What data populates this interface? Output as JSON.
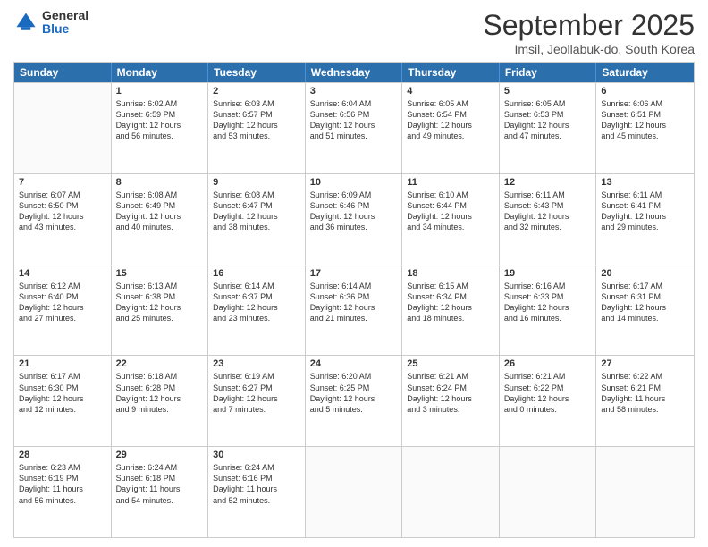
{
  "logo": {
    "general": "General",
    "blue": "Blue"
  },
  "header": {
    "title": "September 2025",
    "subtitle": "Imsil, Jeollabuk-do, South Korea"
  },
  "days": [
    "Sunday",
    "Monday",
    "Tuesday",
    "Wednesday",
    "Thursday",
    "Friday",
    "Saturday"
  ],
  "weeks": [
    [
      {
        "day": "",
        "empty": true
      },
      {
        "day": "1",
        "lines": [
          "Sunrise: 6:02 AM",
          "Sunset: 6:59 PM",
          "Daylight: 12 hours",
          "and 56 minutes."
        ]
      },
      {
        "day": "2",
        "lines": [
          "Sunrise: 6:03 AM",
          "Sunset: 6:57 PM",
          "Daylight: 12 hours",
          "and 53 minutes."
        ]
      },
      {
        "day": "3",
        "lines": [
          "Sunrise: 6:04 AM",
          "Sunset: 6:56 PM",
          "Daylight: 12 hours",
          "and 51 minutes."
        ]
      },
      {
        "day": "4",
        "lines": [
          "Sunrise: 6:05 AM",
          "Sunset: 6:54 PM",
          "Daylight: 12 hours",
          "and 49 minutes."
        ]
      },
      {
        "day": "5",
        "lines": [
          "Sunrise: 6:05 AM",
          "Sunset: 6:53 PM",
          "Daylight: 12 hours",
          "and 47 minutes."
        ]
      },
      {
        "day": "6",
        "lines": [
          "Sunrise: 6:06 AM",
          "Sunset: 6:51 PM",
          "Daylight: 12 hours",
          "and 45 minutes."
        ]
      }
    ],
    [
      {
        "day": "7",
        "lines": [
          "Sunrise: 6:07 AM",
          "Sunset: 6:50 PM",
          "Daylight: 12 hours",
          "and 43 minutes."
        ]
      },
      {
        "day": "8",
        "lines": [
          "Sunrise: 6:08 AM",
          "Sunset: 6:49 PM",
          "Daylight: 12 hours",
          "and 40 minutes."
        ]
      },
      {
        "day": "9",
        "lines": [
          "Sunrise: 6:08 AM",
          "Sunset: 6:47 PM",
          "Daylight: 12 hours",
          "and 38 minutes."
        ]
      },
      {
        "day": "10",
        "lines": [
          "Sunrise: 6:09 AM",
          "Sunset: 6:46 PM",
          "Daylight: 12 hours",
          "and 36 minutes."
        ]
      },
      {
        "day": "11",
        "lines": [
          "Sunrise: 6:10 AM",
          "Sunset: 6:44 PM",
          "Daylight: 12 hours",
          "and 34 minutes."
        ]
      },
      {
        "day": "12",
        "lines": [
          "Sunrise: 6:11 AM",
          "Sunset: 6:43 PM",
          "Daylight: 12 hours",
          "and 32 minutes."
        ]
      },
      {
        "day": "13",
        "lines": [
          "Sunrise: 6:11 AM",
          "Sunset: 6:41 PM",
          "Daylight: 12 hours",
          "and 29 minutes."
        ]
      }
    ],
    [
      {
        "day": "14",
        "lines": [
          "Sunrise: 6:12 AM",
          "Sunset: 6:40 PM",
          "Daylight: 12 hours",
          "and 27 minutes."
        ]
      },
      {
        "day": "15",
        "lines": [
          "Sunrise: 6:13 AM",
          "Sunset: 6:38 PM",
          "Daylight: 12 hours",
          "and 25 minutes."
        ]
      },
      {
        "day": "16",
        "lines": [
          "Sunrise: 6:14 AM",
          "Sunset: 6:37 PM",
          "Daylight: 12 hours",
          "and 23 minutes."
        ]
      },
      {
        "day": "17",
        "lines": [
          "Sunrise: 6:14 AM",
          "Sunset: 6:36 PM",
          "Daylight: 12 hours",
          "and 21 minutes."
        ]
      },
      {
        "day": "18",
        "lines": [
          "Sunrise: 6:15 AM",
          "Sunset: 6:34 PM",
          "Daylight: 12 hours",
          "and 18 minutes."
        ]
      },
      {
        "day": "19",
        "lines": [
          "Sunrise: 6:16 AM",
          "Sunset: 6:33 PM",
          "Daylight: 12 hours",
          "and 16 minutes."
        ]
      },
      {
        "day": "20",
        "lines": [
          "Sunrise: 6:17 AM",
          "Sunset: 6:31 PM",
          "Daylight: 12 hours",
          "and 14 minutes."
        ]
      }
    ],
    [
      {
        "day": "21",
        "lines": [
          "Sunrise: 6:17 AM",
          "Sunset: 6:30 PM",
          "Daylight: 12 hours",
          "and 12 minutes."
        ]
      },
      {
        "day": "22",
        "lines": [
          "Sunrise: 6:18 AM",
          "Sunset: 6:28 PM",
          "Daylight: 12 hours",
          "and 9 minutes."
        ]
      },
      {
        "day": "23",
        "lines": [
          "Sunrise: 6:19 AM",
          "Sunset: 6:27 PM",
          "Daylight: 12 hours",
          "and 7 minutes."
        ]
      },
      {
        "day": "24",
        "lines": [
          "Sunrise: 6:20 AM",
          "Sunset: 6:25 PM",
          "Daylight: 12 hours",
          "and 5 minutes."
        ]
      },
      {
        "day": "25",
        "lines": [
          "Sunrise: 6:21 AM",
          "Sunset: 6:24 PM",
          "Daylight: 12 hours",
          "and 3 minutes."
        ]
      },
      {
        "day": "26",
        "lines": [
          "Sunrise: 6:21 AM",
          "Sunset: 6:22 PM",
          "Daylight: 12 hours",
          "and 0 minutes."
        ]
      },
      {
        "day": "27",
        "lines": [
          "Sunrise: 6:22 AM",
          "Sunset: 6:21 PM",
          "Daylight: 11 hours",
          "and 58 minutes."
        ]
      }
    ],
    [
      {
        "day": "28",
        "lines": [
          "Sunrise: 6:23 AM",
          "Sunset: 6:19 PM",
          "Daylight: 11 hours",
          "and 56 minutes."
        ]
      },
      {
        "day": "29",
        "lines": [
          "Sunrise: 6:24 AM",
          "Sunset: 6:18 PM",
          "Daylight: 11 hours",
          "and 54 minutes."
        ]
      },
      {
        "day": "30",
        "lines": [
          "Sunrise: 6:24 AM",
          "Sunset: 6:16 PM",
          "Daylight: 11 hours",
          "and 52 minutes."
        ]
      },
      {
        "day": "",
        "empty": true
      },
      {
        "day": "",
        "empty": true
      },
      {
        "day": "",
        "empty": true
      },
      {
        "day": "",
        "empty": true
      }
    ]
  ]
}
